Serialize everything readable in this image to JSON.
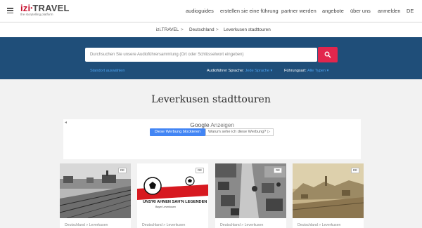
{
  "header": {
    "logo": {
      "brand_left": "izi",
      "brand_right": "TRAVEL",
      "tagline": "the storytelling platform"
    },
    "nav": [
      "audioguides",
      "erstellen sie eine führung",
      "partner werden",
      "angebote",
      "über uns",
      "anmelden"
    ],
    "language": "DE"
  },
  "breadcrumb": {
    "items": [
      "izi.TRAVEL",
      "Deutschland",
      "Leverkusen stadttouren"
    ],
    "separator": ">"
  },
  "search": {
    "placeholder": "Durchsuchen Sie unsere Audioführersammlung (Ort oder Schlüsselwort eingeben)",
    "location_link": "Standort auswählen",
    "language_label": "Audioführer Sprache:",
    "language_value": "Jede Sprache",
    "type_label": "Führungsart:",
    "type_value": "Alle Typen"
  },
  "page_title": "Leverkusen stadttouren",
  "ad": {
    "arrow": "◂",
    "google": "Google",
    "label": "Anzeigen",
    "block_button": "Diese Werbung blockieren",
    "why_button": "Warum sehe ich diese Werbung?",
    "why_icon": "▷"
  },
  "cards": [
    {
      "badge": "DE",
      "location": "Deutschland  »  Leverkusen"
    },
    {
      "badge": "DE",
      "location": "Deutschland  »  Leverkusen",
      "poster_text": "UNS'RI AHNEN SAH'N LEGENDEN",
      "poster_sub": "Bayer Leverkusen"
    },
    {
      "badge": "DE",
      "location": "Deutschland  »  Leverkusen"
    },
    {
      "badge": "DE",
      "location": "Deutschland  »  Leverkusen"
    }
  ],
  "colors": {
    "hero": "#1f4e79",
    "search_button": "#e2264d",
    "link": "#4ea3f0",
    "ad_button": "#4285f4"
  }
}
